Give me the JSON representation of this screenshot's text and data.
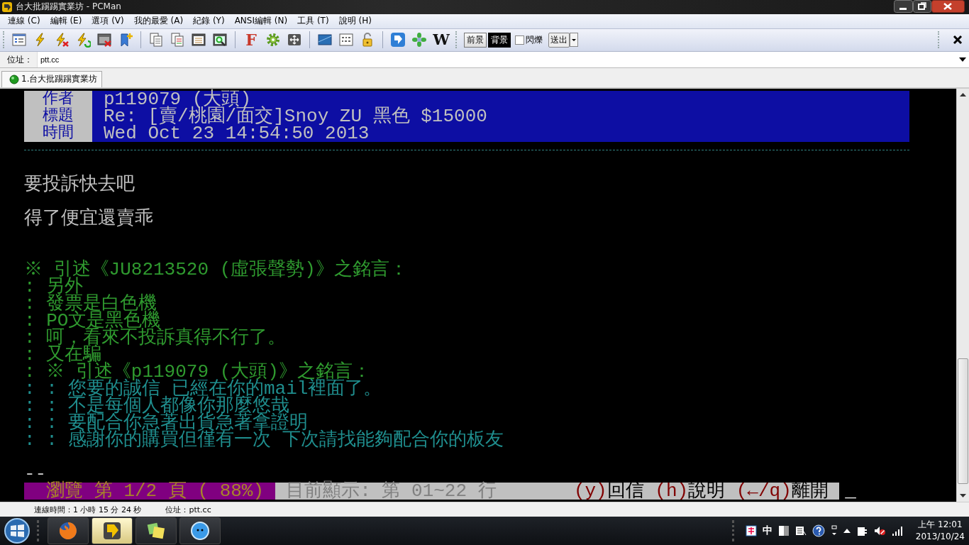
{
  "window": {
    "title": "台大批踢踢實業坊 - PCMan"
  },
  "menu": [
    "連線 (C)",
    "編輯 (E)",
    "選項 (V)",
    "我的最愛 (A)",
    "紀錄 (Y)",
    "ANSI編輯 (N)",
    "工具 (T)",
    "說明 (H)"
  ],
  "toolbar": {
    "font_button": "F",
    "wiki_button": "W",
    "color_buttons": [
      {
        "label": "前景",
        "selected": false
      },
      {
        "label": "背景",
        "selected": true
      }
    ],
    "blink": {
      "label": "閃爍",
      "checked": false
    },
    "send_button": "送出"
  },
  "address": {
    "label": "位址：",
    "value": "ptt.cc"
  },
  "tabs": [
    {
      "label": "1.台大批踢踢實業坊",
      "selected": true
    }
  ],
  "terminal": {
    "header": [
      {
        "label": "作者",
        "value": "p119079 (大頭)"
      },
      {
        "label": "標題",
        "value": "Re: [賣/桃園/面交]Snoy ZU 黑色 $15000"
      },
      {
        "label": "時間",
        "value": "Wed Oct 23 14:54:50 2013"
      }
    ],
    "lines": [
      {
        "kind": "separator"
      },
      {
        "kind": "blank"
      },
      {
        "kind": "text",
        "text": "要投訴快去吧"
      },
      {
        "kind": "blank"
      },
      {
        "kind": "text",
        "text": "得了便宜還賣乖"
      },
      {
        "kind": "blank"
      },
      {
        "kind": "blank"
      },
      {
        "kind": "quote",
        "text": "※ 引述《JU8213520 (虛張聲勢)》之銘言："
      },
      {
        "kind": "quote",
        "text": ": 另外"
      },
      {
        "kind": "quote",
        "text": ": 發票是白色機"
      },
      {
        "kind": "quote",
        "text": ": PO文是黑色機"
      },
      {
        "kind": "quote",
        "text": ": 呵，看來不投訴真得不行了。"
      },
      {
        "kind": "quote",
        "text": ": 又在騙"
      },
      {
        "kind": "quote",
        "text": ": ※ 引述《p119079 (大頭)》之銘言："
      },
      {
        "kind": "nested_quote",
        "text": ": : 您要的誠信 已經在你的mail裡面了。"
      },
      {
        "kind": "nested_quote",
        "text": ": : 不是每個人都像你那麼悠哉"
      },
      {
        "kind": "nested_quote",
        "text": ": : 要配合你急著出貨急著拿證明"
      },
      {
        "kind": "nested_quote",
        "text": ": : 感謝你的購買但僅有一次 下次請找能夠配合你的板友"
      },
      {
        "kind": "blank"
      },
      {
        "kind": "text",
        "text": "--"
      }
    ],
    "footer": [
      {
        "kind": "page",
        "text": "  瀏覽 第 1/2 頁 ( 88%) "
      },
      {
        "kind": "info",
        "text": " 目前顯示: 第 01~22 行       "
      },
      {
        "kind": "key",
        "text": "(y)"
      },
      {
        "kind": "label",
        "text": "回信 "
      },
      {
        "kind": "key",
        "text": "(h)"
      },
      {
        "kind": "label",
        "text": "說明 "
      },
      {
        "kind": "key",
        "text": "(←/q)"
      },
      {
        "kind": "label",
        "text": "離開 "
      }
    ],
    "cursor": "_"
  },
  "status_bar": [
    "連線時間：1 小時 15 分 24 秒",
    "位址：ptt.cc"
  ],
  "taskbar": {
    "ime": "中",
    "clock": {
      "time": "上午 12:01",
      "date": "2013/10/24"
    }
  }
}
